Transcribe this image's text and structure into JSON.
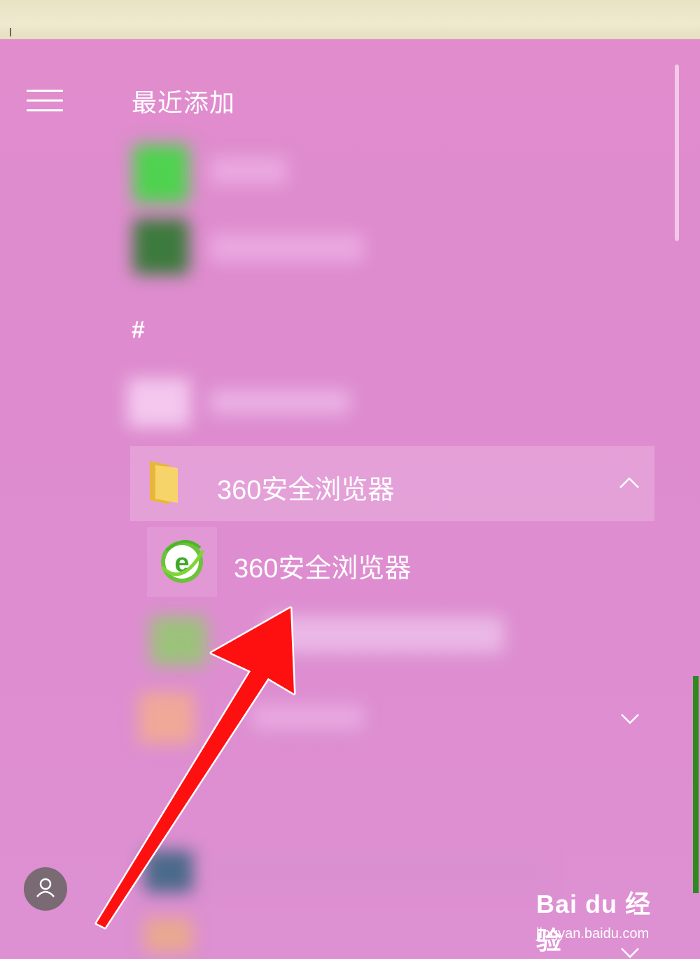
{
  "start_menu": {
    "section_recent": "最近添加",
    "section_hash": "#",
    "folder": {
      "label": "360安全浏览器",
      "icon": "folder-icon",
      "expanded": true
    },
    "app": {
      "label": "360安全浏览器",
      "icon": "360-browser-icon"
    }
  },
  "colors": {
    "menu_bg": "#df8ecf",
    "folder_row_bg": "rgba(255,255,255,0.18)",
    "arrow": "#ff1010"
  },
  "watermark": {
    "logo": "Bai du 经验",
    "url": "jingyan.baidu.com"
  }
}
